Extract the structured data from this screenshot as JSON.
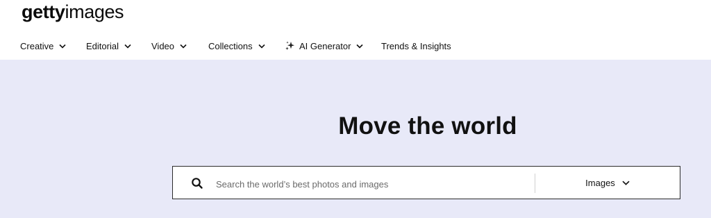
{
  "logo": {
    "part1": "getty",
    "part2": "images"
  },
  "nav": {
    "items": [
      {
        "label": "Creative",
        "chevron": true
      },
      {
        "label": "Editorial",
        "chevron": true
      },
      {
        "label": "Video",
        "chevron": true
      },
      {
        "label": "Collections",
        "chevron": true
      },
      {
        "label": "AI Generator",
        "chevron": true,
        "icon": "sparkle-icon"
      },
      {
        "label": "Trends & Insights",
        "chevron": false
      }
    ]
  },
  "hero": {
    "title": "Move the world",
    "background": "#e8e9f8",
    "search": {
      "placeholder": "Search the world’s best photos and images",
      "value": "",
      "type_label": "Images"
    }
  }
}
